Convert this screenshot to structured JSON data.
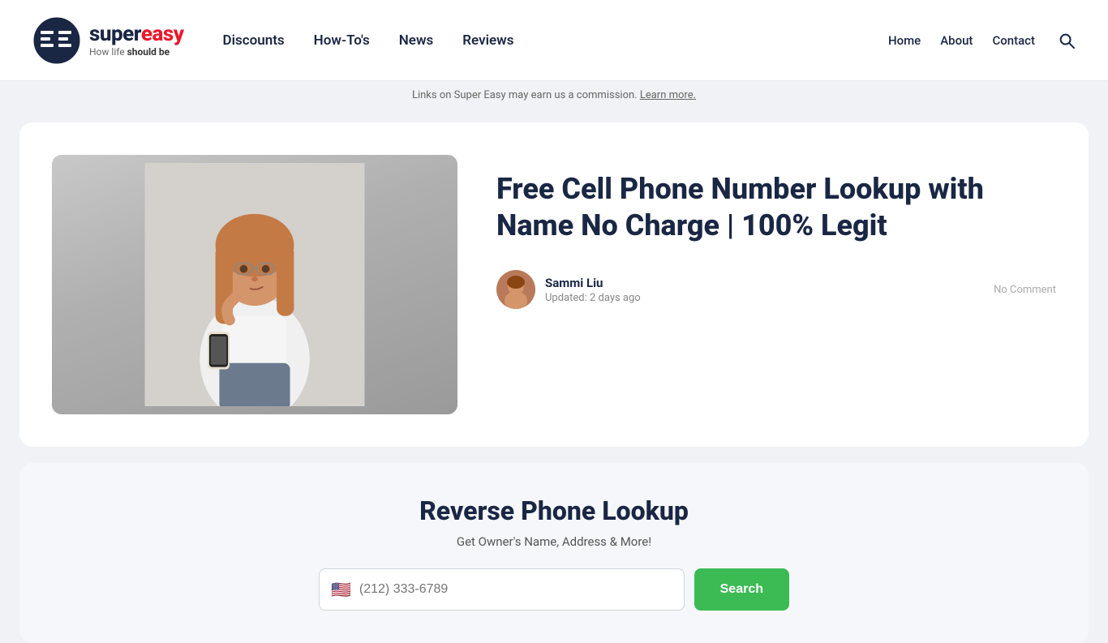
{
  "header": {
    "logo": {
      "super_text": "super",
      "easy_text": "easy",
      "tagline_normal": "How life ",
      "tagline_bold": "should be"
    },
    "main_nav": [
      {
        "label": "Discounts",
        "id": "discounts"
      },
      {
        "label": "How-To's",
        "id": "howtos"
      },
      {
        "label": "News",
        "id": "news"
      },
      {
        "label": "Reviews",
        "id": "reviews"
      }
    ],
    "secondary_nav": [
      {
        "label": "Home",
        "id": "home"
      },
      {
        "label": "About",
        "id": "about"
      },
      {
        "label": "Contact",
        "id": "contact"
      }
    ],
    "search_label": "search"
  },
  "affiliate_bar": {
    "text": "Links on Super Easy may earn us a commission. ",
    "link_text": "Learn more."
  },
  "article": {
    "title": "Free Cell Phone Number Lookup with Name No Charge | 100% Legit",
    "author_name": "Sammi Liu",
    "updated_label": "Updated: 2 days ago",
    "no_comment_label": "No Comment"
  },
  "widget": {
    "title": "Reverse Phone Lookup",
    "subtitle": "Get Owner's Name, Address & More!",
    "phone_placeholder": "(212) 333-6789",
    "search_button_label": "Search"
  }
}
